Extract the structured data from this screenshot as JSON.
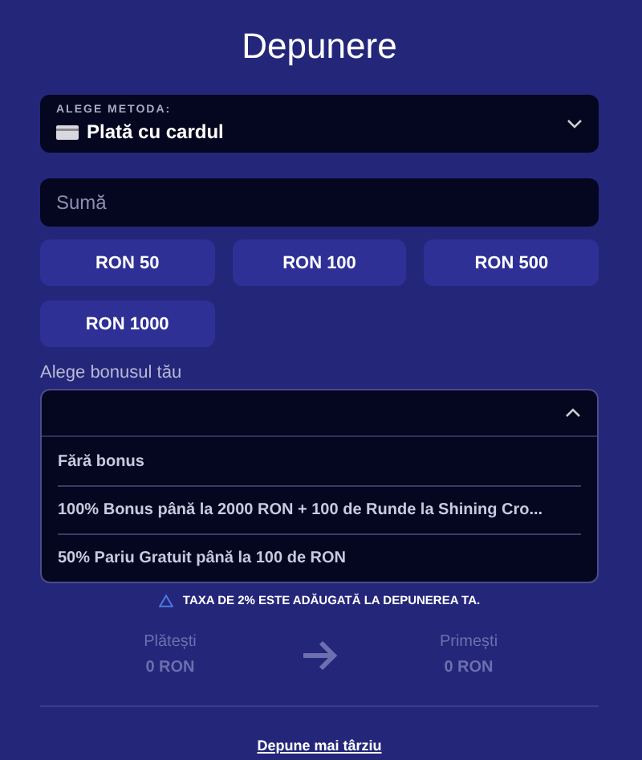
{
  "title": "Depunere",
  "method": {
    "label": "ALEGE METODA:",
    "value": "Plată cu cardul"
  },
  "amount": {
    "placeholder": "Sumă"
  },
  "presets": [
    "RON 50",
    "RON 100",
    "RON 500",
    "RON 1000"
  ],
  "bonus": {
    "label": "Alege bonusul tău",
    "expanded": true,
    "options": [
      {
        "label": "Fără bonus"
      },
      {
        "label": "100% Bonus până la 2000 RON + 100 de Runde la Shining Cro..."
      },
      {
        "label": "50% Pariu Gratuit până la 100 de RON"
      }
    ]
  },
  "notice": "TAXA DE 2% ESTE ADĂUGATĂ LA DEPUNEREA TA.",
  "summary": {
    "pay": {
      "label": "Plătești",
      "value": "0 RON"
    },
    "receive": {
      "label": "Primești",
      "value": "0 RON"
    }
  },
  "later_link": "Depune mai târziu"
}
